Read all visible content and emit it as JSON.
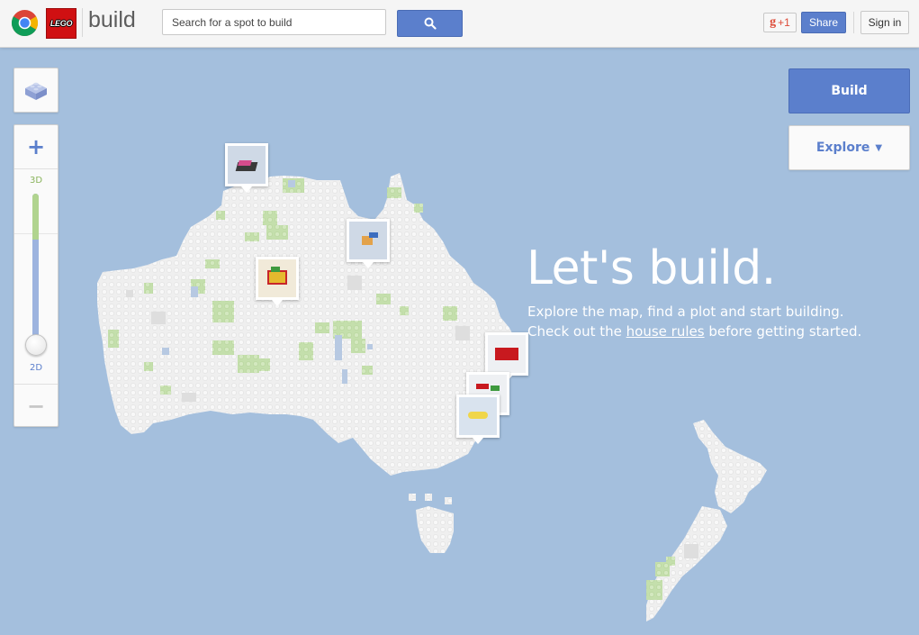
{
  "header": {
    "brand_logo_text": "LEGO",
    "brand": "build",
    "search_placeholder": "Search for a spot to build",
    "gplus_label": "+1",
    "share_label": "Share",
    "signin_label": "Sign in"
  },
  "zoom": {
    "plus_label": "+",
    "minus_label": "−",
    "mode_3d": "3D",
    "mode_2d": "2D",
    "level": 0
  },
  "actions": {
    "build_label": "Build",
    "explore_label": "Explore"
  },
  "hero": {
    "title": "Let's build.",
    "line1": "Explore the map, find a plot and start building.",
    "line2_prefix": "Check out the",
    "line2_link": "house rules",
    "line2_suffix": "before getting started."
  },
  "colors": {
    "accent": "#5b7fcc",
    "water": "#a4bfdd",
    "land": "#efefef",
    "grass": "#c4dfac",
    "lake": "#b7c9e2"
  },
  "icons": [
    "chrome-logo-icon",
    "lego-logo-icon",
    "search-icon",
    "gplus-icon",
    "lego-brick-icon",
    "caret-down-icon"
  ]
}
